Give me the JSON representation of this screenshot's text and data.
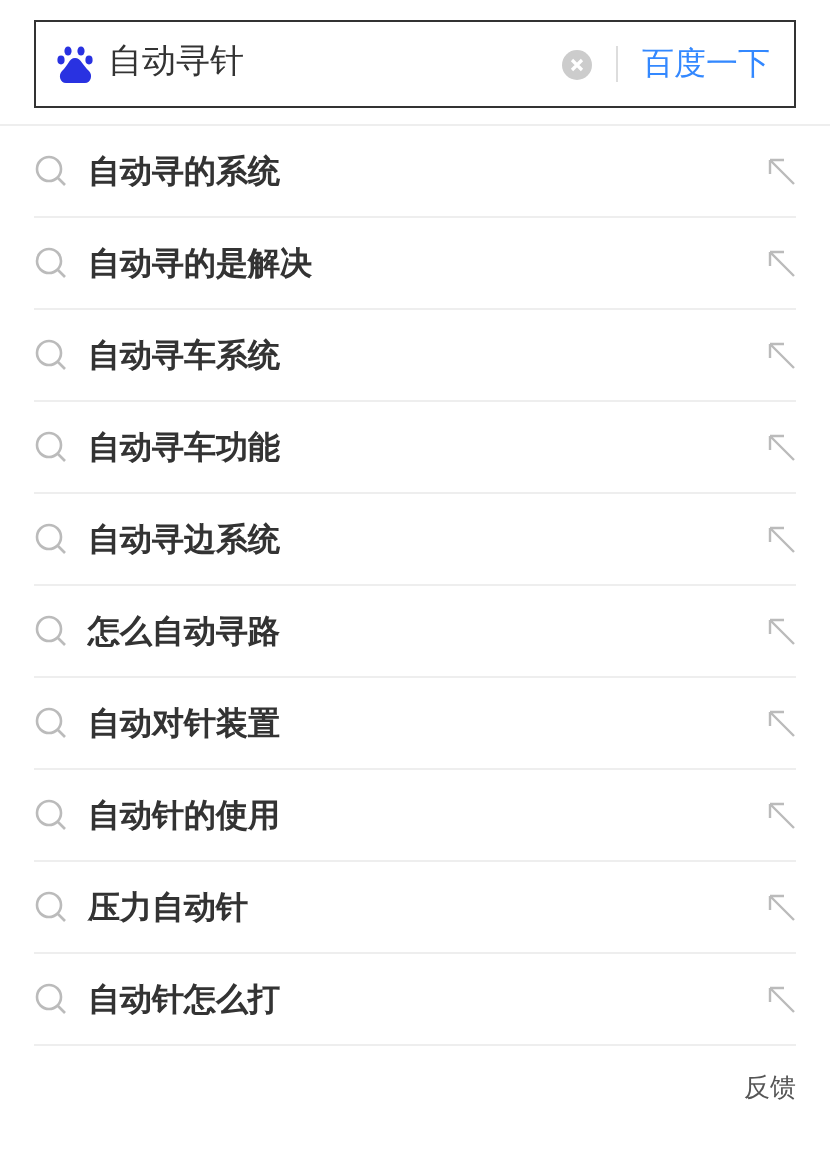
{
  "search": {
    "value": "自动寻针",
    "button": "百度一下"
  },
  "suggestions": [
    {
      "text": "自动寻的系统"
    },
    {
      "text": "自动寻的是解决"
    },
    {
      "text": "自动寻车系统"
    },
    {
      "text": "自动寻车功能"
    },
    {
      "text": "自动寻边系统"
    },
    {
      "text": "怎么自动寻路"
    },
    {
      "text": "自动对针装置"
    },
    {
      "text": "自动针的使用"
    },
    {
      "text": "压力自动针"
    },
    {
      "text": "自动针怎么打"
    }
  ],
  "feedback": "反馈"
}
